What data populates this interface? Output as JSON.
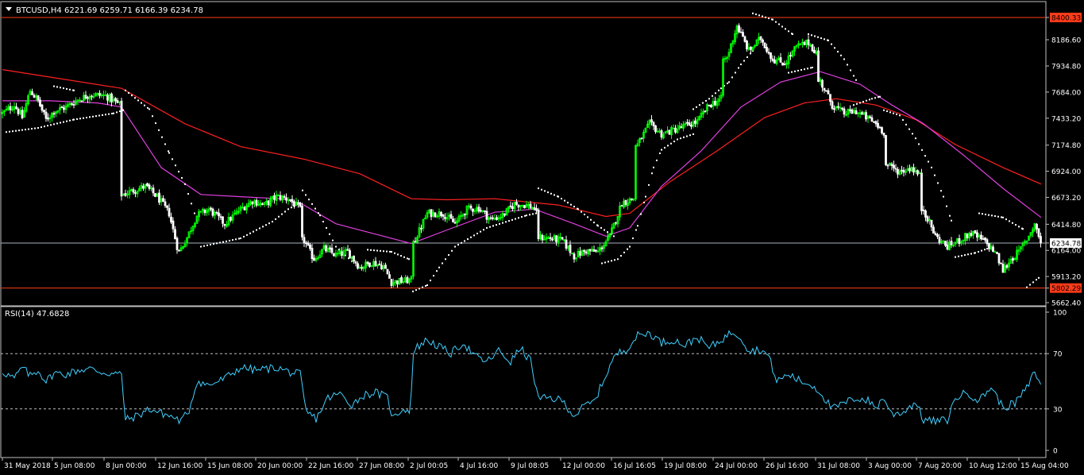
{
  "symbol_header": {
    "symbol_tf": "BTCUSD,H4",
    "ohlc": "6221.69 6259.71 6166.39 6234.78"
  },
  "colors": {
    "background": "#000000",
    "frame": "#c0c0c0",
    "bull_candle": "#00ff00",
    "bear_candle": "#ffffff",
    "ma_slow": "#ff2020",
    "ma_fast": "#e040e0",
    "sar": "#ffffff",
    "hline": "#ff3b1a",
    "price_line": "#a8b4c0",
    "rsi_line": "#3fd0ff",
    "rsi_level": "#c0c0c0",
    "tag_bg": "#ff3b1a",
    "current_tag_bg": "#ffffff"
  },
  "chart_data": [
    {
      "type": "candlestick",
      "name": "BTCUSD,H4",
      "ylim": [
        5662.4,
        8400.33
      ],
      "y_ticks": [
        "8400.33",
        "8186.60",
        "7934.80",
        "7684.00",
        "7433.20",
        "7174.80",
        "6924.00",
        "6673.20",
        "6414.80",
        "6234.78",
        "6164.00",
        "5913.20",
        "5802.29",
        "5662.40"
      ],
      "highlighted_ticks": {
        "8400.33": "level",
        "5802.29": "level",
        "6234.78": "current"
      },
      "x_ticks": [
        "31 May 2018",
        "5 Jun 08:00",
        "8 Jun 00:00",
        "12 Jun 16:00",
        "15 Jun 08:00",
        "20 Jun 00:00",
        "22 Jun 16:00",
        "27 Jun 08:00",
        "2 Jul 00:05",
        "4 Jul 16:00",
        "9 Jul 08:05",
        "12 Jul 00:00",
        "16 Jul 16:05",
        "19 Jul 08:00",
        "24 Jul 00:00",
        "26 Jul 16:00",
        "31 Jul 08:00",
        "3 Aug 00:00",
        "7 Aug 20:00",
        "10 Aug 12:00",
        "15 Aug 04:00"
      ],
      "horizontal_levels": [
        8400.33,
        5802.29
      ],
      "current_price": 6234.78,
      "anchor_closes": [
        [
          0,
          7480
        ],
        [
          15,
          7560
        ],
        [
          25,
          7440
        ],
        [
          35,
          7700
        ],
        [
          45,
          7600
        ],
        [
          55,
          7420
        ],
        [
          65,
          7500
        ],
        [
          80,
          7540
        ],
        [
          95,
          7610
        ],
        [
          110,
          7660
        ],
        [
          130,
          7650
        ],
        [
          148,
          7560
        ],
        [
          152,
          6700
        ],
        [
          165,
          6740
        ],
        [
          180,
          6780
        ],
        [
          195,
          6680
        ],
        [
          210,
          6520
        ],
        [
          222,
          6140
        ],
        [
          232,
          6280
        ],
        [
          245,
          6500
        ],
        [
          260,
          6560
        ],
        [
          280,
          6420
        ],
        [
          300,
          6560
        ],
        [
          315,
          6640
        ],
        [
          330,
          6600
        ],
        [
          345,
          6680
        ],
        [
          360,
          6660
        ],
        [
          375,
          6560
        ],
        [
          380,
          6260
        ],
        [
          392,
          6080
        ],
        [
          405,
          6180
        ],
        [
          420,
          6120
        ],
        [
          435,
          6150
        ],
        [
          450,
          6000
        ],
        [
          465,
          6050
        ],
        [
          480,
          6010
        ],
        [
          490,
          5860
        ],
        [
          505,
          5870
        ],
        [
          515,
          5880
        ],
        [
          520,
          6270
        ],
        [
          535,
          6520
        ],
        [
          555,
          6520
        ],
        [
          570,
          6420
        ],
        [
          585,
          6560
        ],
        [
          600,
          6570
        ],
        [
          615,
          6460
        ],
        [
          630,
          6500
        ],
        [
          645,
          6610
        ],
        [
          660,
          6600
        ],
        [
          672,
          6560
        ],
        [
          675,
          6290
        ],
        [
          690,
          6280
        ],
        [
          705,
          6260
        ],
        [
          720,
          6110
        ],
        [
          735,
          6160
        ],
        [
          750,
          6150
        ],
        [
          765,
          6300
        ],
        [
          780,
          6620
        ],
        [
          795,
          6660
        ],
        [
          800,
          7180
        ],
        [
          815,
          7380
        ],
        [
          830,
          7280
        ],
        [
          845,
          7320
        ],
        [
          860,
          7360
        ],
        [
          875,
          7400
        ],
        [
          890,
          7560
        ],
        [
          905,
          7620
        ],
        [
          912,
          8000
        ],
        [
          925,
          8320
        ],
        [
          940,
          8080
        ],
        [
          955,
          8200
        ],
        [
          970,
          8000
        ],
        [
          985,
          7960
        ],
        [
          1000,
          8120
        ],
        [
          1015,
          8160
        ],
        [
          1025,
          8060
        ],
        [
          1030,
          7790
        ],
        [
          1045,
          7560
        ],
        [
          1060,
          7480
        ],
        [
          1075,
          7500
        ],
        [
          1090,
          7430
        ],
        [
          1100,
          7380
        ],
        [
          1110,
          7300
        ],
        [
          1115,
          6980
        ],
        [
          1130,
          6920
        ],
        [
          1145,
          6960
        ],
        [
          1155,
          6880
        ],
        [
          1160,
          6560
        ],
        [
          1175,
          6300
        ],
        [
          1190,
          6200
        ],
        [
          1205,
          6260
        ],
        [
          1220,
          6330
        ],
        [
          1235,
          6260
        ],
        [
          1250,
          6150
        ],
        [
          1260,
          5970
        ],
        [
          1270,
          6080
        ],
        [
          1280,
          6150
        ],
        [
          1290,
          6270
        ],
        [
          1300,
          6420
        ],
        [
          1308,
          6234.78
        ]
      ],
      "ma_slow": [
        [
          0,
          7900
        ],
        [
          150,
          7720
        ],
        [
          230,
          7380
        ],
        [
          300,
          7160
        ],
        [
          380,
          7040
        ],
        [
          450,
          6900
        ],
        [
          515,
          6660
        ],
        [
          560,
          6650
        ],
        [
          620,
          6660
        ],
        [
          700,
          6600
        ],
        [
          760,
          6490
        ],
        [
          790,
          6520
        ],
        [
          840,
          6820
        ],
        [
          900,
          7120
        ],
        [
          960,
          7440
        ],
        [
          1010,
          7580
        ],
        [
          1050,
          7620
        ],
        [
          1100,
          7560
        ],
        [
          1150,
          7420
        ],
        [
          1200,
          7180
        ],
        [
          1260,
          6960
        ],
        [
          1308,
          6800
        ]
      ],
      "ma_fast": [
        [
          0,
          7600
        ],
        [
          60,
          7600
        ],
        [
          120,
          7580
        ],
        [
          150,
          7540
        ],
        [
          200,
          6960
        ],
        [
          250,
          6700
        ],
        [
          300,
          6680
        ],
        [
          350,
          6660
        ],
        [
          375,
          6620
        ],
        [
          420,
          6420
        ],
        [
          470,
          6320
        ],
        [
          515,
          6230
        ],
        [
          560,
          6360
        ],
        [
          620,
          6530
        ],
        [
          670,
          6560
        ],
        [
          720,
          6420
        ],
        [
          760,
          6300
        ],
        [
          790,
          6380
        ],
        [
          830,
          6780
        ],
        [
          880,
          7120
        ],
        [
          930,
          7540
        ],
        [
          980,
          7780
        ],
        [
          1030,
          7880
        ],
        [
          1080,
          7760
        ],
        [
          1120,
          7560
        ],
        [
          1160,
          7380
        ],
        [
          1210,
          7080
        ],
        [
          1260,
          6760
        ],
        [
          1308,
          6480
        ]
      ],
      "sar_segments": [
        [
          [
            5,
            7300
          ],
          [
            45,
            7340
          ],
          [
            90,
            7420
          ],
          [
            140,
            7480
          ],
          [
            152,
            7510
          ]
        ],
        [
          [
            65,
            7740
          ],
          [
            90,
            7700
          ]
        ],
        [
          [
            155,
            7700
          ],
          [
            185,
            7520
          ],
          [
            210,
            7100
          ],
          [
            230,
            6800
          ],
          [
            245,
            6450
          ]
        ],
        [
          [
            250,
            6200
          ],
          [
            300,
            6280
          ],
          [
            340,
            6440
          ],
          [
            360,
            6560
          ],
          [
            375,
            6620
          ]
        ],
        [
          [
            378,
            6740
          ],
          [
            400,
            6500
          ],
          [
            420,
            6200
          ],
          [
            440,
            6060
          ]
        ],
        [
          [
            460,
            6170
          ],
          [
            490,
            6150
          ],
          [
            512,
            6080
          ]
        ],
        [
          [
            517,
            5770
          ],
          [
            535,
            5830
          ],
          [
            550,
            6000
          ],
          [
            570,
            6200
          ],
          [
            610,
            6380
          ],
          [
            660,
            6500
          ],
          [
            672,
            6520
          ]
        ],
        [
          [
            675,
            6760
          ],
          [
            700,
            6680
          ],
          [
            725,
            6560
          ],
          [
            750,
            6400
          ],
          [
            770,
            6300
          ]
        ],
        [
          [
            755,
            6040
          ],
          [
            775,
            6080
          ],
          [
            790,
            6200
          ],
          [
            800,
            6400
          ],
          [
            810,
            6680
          ],
          [
            820,
            6960
          ],
          [
            830,
            7130
          ],
          [
            850,
            7230
          ],
          [
            870,
            7280
          ]
        ],
        [
          [
            870,
            7520
          ],
          [
            890,
            7620
          ],
          [
            905,
            7720
          ],
          [
            915,
            7780
          ],
          [
            930,
            7950
          ],
          [
            945,
            8080
          ]
        ],
        [
          [
            945,
            8440
          ],
          [
            970,
            8380
          ],
          [
            995,
            8240
          ]
        ],
        [
          [
            990,
            7870
          ],
          [
            1020,
            7920
          ]
        ],
        [
          [
            1015,
            8240
          ],
          [
            1040,
            8180
          ],
          [
            1060,
            8000
          ],
          [
            1075,
            7800
          ]
        ],
        [
          [
            1072,
            7560
          ],
          [
            1095,
            7620
          ],
          [
            1105,
            7640
          ]
        ],
        [
          [
            1110,
            7510
          ],
          [
            1130,
            7460
          ],
          [
            1150,
            7240
          ],
          [
            1170,
            6960
          ],
          [
            1185,
            6680
          ],
          [
            1195,
            6450
          ]
        ],
        [
          [
            1200,
            6100
          ],
          [
            1225,
            6140
          ],
          [
            1240,
            6180
          ]
        ],
        [
          [
            1230,
            6520
          ],
          [
            1260,
            6480
          ],
          [
            1285,
            6370
          ]
        ],
        [
          [
            1290,
            5810
          ],
          [
            1305,
            5900
          ]
        ]
      ]
    },
    {
      "type": "line",
      "name": "RSI(14)",
      "ylim": [
        0,
        100
      ],
      "y_ticks": [
        "100",
        "70",
        "30",
        "0"
      ],
      "levels": [
        70,
        30
      ],
      "current_value": 47.6828,
      "anchor_values": [
        [
          0,
          57
        ],
        [
          15,
          52
        ],
        [
          25,
          60
        ],
        [
          35,
          54
        ],
        [
          45,
          58
        ],
        [
          55,
          50
        ],
        [
          65,
          56
        ],
        [
          80,
          55
        ],
        [
          95,
          58
        ],
        [
          110,
          59
        ],
        [
          130,
          56
        ],
        [
          150,
          55
        ],
        [
          155,
          22
        ],
        [
          170,
          25
        ],
        [
          185,
          30
        ],
        [
          200,
          27
        ],
        [
          215,
          24
        ],
        [
          225,
          21
        ],
        [
          235,
          29
        ],
        [
          245,
          50
        ],
        [
          260,
          47
        ],
        [
          280,
          52
        ],
        [
          300,
          60
        ],
        [
          320,
          58
        ],
        [
          345,
          60
        ],
        [
          365,
          56
        ],
        [
          375,
          55
        ],
        [
          382,
          28
        ],
        [
          395,
          23
        ],
        [
          410,
          38
        ],
        [
          425,
          41
        ],
        [
          440,
          33
        ],
        [
          455,
          40
        ],
        [
          470,
          42
        ],
        [
          485,
          38
        ],
        [
          492,
          23
        ],
        [
          505,
          31
        ],
        [
          513,
          27
        ],
        [
          518,
          73
        ],
        [
          535,
          80
        ],
        [
          550,
          75
        ],
        [
          565,
          70
        ],
        [
          580,
          78
        ],
        [
          595,
          68
        ],
        [
          610,
          64
        ],
        [
          625,
          72
        ],
        [
          640,
          64
        ],
        [
          652,
          74
        ],
        [
          665,
          65
        ],
        [
          675,
          37
        ],
        [
          690,
          38
        ],
        [
          705,
          36
        ],
        [
          720,
          25
        ],
        [
          735,
          33
        ],
        [
          745,
          35
        ],
        [
          755,
          48
        ],
        [
          768,
          65
        ],
        [
          775,
          70
        ],
        [
          785,
          73
        ],
        [
          800,
          83
        ],
        [
          815,
          85
        ],
        [
          830,
          78
        ],
        [
          845,
          80
        ],
        [
          860,
          76
        ],
        [
          875,
          82
        ],
        [
          890,
          74
        ],
        [
          905,
          80
        ],
        [
          920,
          86
        ],
        [
          930,
          82
        ],
        [
          940,
          72
        ],
        [
          955,
          73
        ],
        [
          965,
          68
        ],
        [
          975,
          50
        ],
        [
          990,
          55
        ],
        [
          1005,
          50
        ],
        [
          1020,
          47
        ],
        [
          1030,
          42
        ],
        [
          1045,
          30
        ],
        [
          1060,
          34
        ],
        [
          1075,
          38
        ],
        [
          1090,
          36
        ],
        [
          1100,
          31
        ],
        [
          1110,
          38
        ],
        [
          1120,
          26
        ],
        [
          1135,
          28
        ],
        [
          1150,
          35
        ],
        [
          1160,
          22
        ],
        [
          1175,
          21
        ],
        [
          1190,
          22
        ],
        [
          1200,
          38
        ],
        [
          1215,
          42
        ],
        [
          1230,
          36
        ],
        [
          1245,
          46
        ],
        [
          1260,
          31
        ],
        [
          1275,
          34
        ],
        [
          1290,
          45
        ],
        [
          1300,
          57
        ],
        [
          1308,
          47.7
        ]
      ]
    }
  ]
}
